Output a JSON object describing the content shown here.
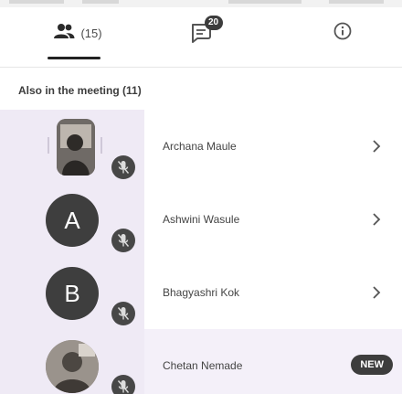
{
  "tabs": {
    "people": {
      "icon": "people-icon",
      "count": "(15)"
    },
    "chat": {
      "icon": "chat-icon",
      "badge": "20"
    },
    "info": {
      "icon": "info-icon"
    }
  },
  "section": {
    "title": "Also in the meeting (11)"
  },
  "participants": [
    {
      "name": "Archana Maule",
      "avatar_type": "photo",
      "muted": true,
      "action": "chevron-right-icon"
    },
    {
      "name": "Ashwini Wasule",
      "avatar_type": "letter",
      "avatar_letter": "A",
      "muted": true,
      "action": "chevron-right-icon"
    },
    {
      "name": "Bhagyashri Kok",
      "avatar_type": "letter",
      "avatar_letter": "B",
      "muted": true,
      "action": "chevron-right-icon"
    },
    {
      "name": "Chetan Nemade",
      "avatar_type": "photo",
      "muted": true,
      "badge": "NEW"
    }
  ],
  "colors": {
    "avatar_bg": "#3e3e3e",
    "highlight_bg": "#efeaf5",
    "badge_bg": "#3d3d3d"
  }
}
